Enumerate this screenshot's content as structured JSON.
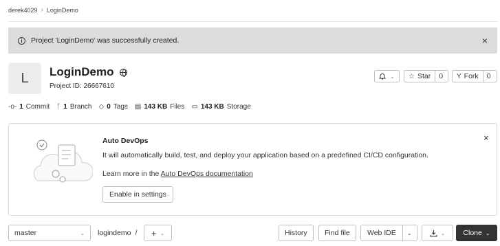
{
  "breadcrumb": {
    "user": "derek4029",
    "separator": "›",
    "project": "LoginDemo"
  },
  "alert": {
    "message": "Project 'LoginDemo' was successfully created.",
    "close": "×"
  },
  "project": {
    "avatar_letter": "L",
    "name": "LoginDemo",
    "id_text": "Project ID: 26667610"
  },
  "actions": {
    "star_label": "Star",
    "star_count": "0",
    "fork_label": "Fork",
    "fork_count": "0"
  },
  "stats": [
    {
      "icon": "commit-icon",
      "glyph": "-o-",
      "value": "1",
      "label": "Commit"
    },
    {
      "icon": "branch-icon",
      "glyph": "ᚴ",
      "value": "1",
      "label": "Branch"
    },
    {
      "icon": "tag-icon",
      "glyph": "◇",
      "value": "0",
      "label": "Tags"
    },
    {
      "icon": "files-icon",
      "glyph": "▤",
      "value": "143 KB",
      "label": "Files"
    },
    {
      "icon": "storage-icon",
      "glyph": "▭",
      "value": "143 KB",
      "label": "Storage"
    }
  ],
  "devops": {
    "title": "Auto DevOps",
    "text": "It will automatically build, test, and deploy your application based on a predefined CI/CD configuration.",
    "learn_prefix": "Learn more in the ",
    "learn_link": "Auto DevOps documentation",
    "enable_label": "Enable in settings"
  },
  "repo": {
    "branch": "master",
    "path": "logindemo",
    "path_sep": "/",
    "history": "History",
    "find_file": "Find file",
    "web_ide": "Web IDE",
    "clone": "Clone"
  },
  "colors": {
    "alert_bg": "#dcdcde",
    "clone_bg": "#333333"
  }
}
